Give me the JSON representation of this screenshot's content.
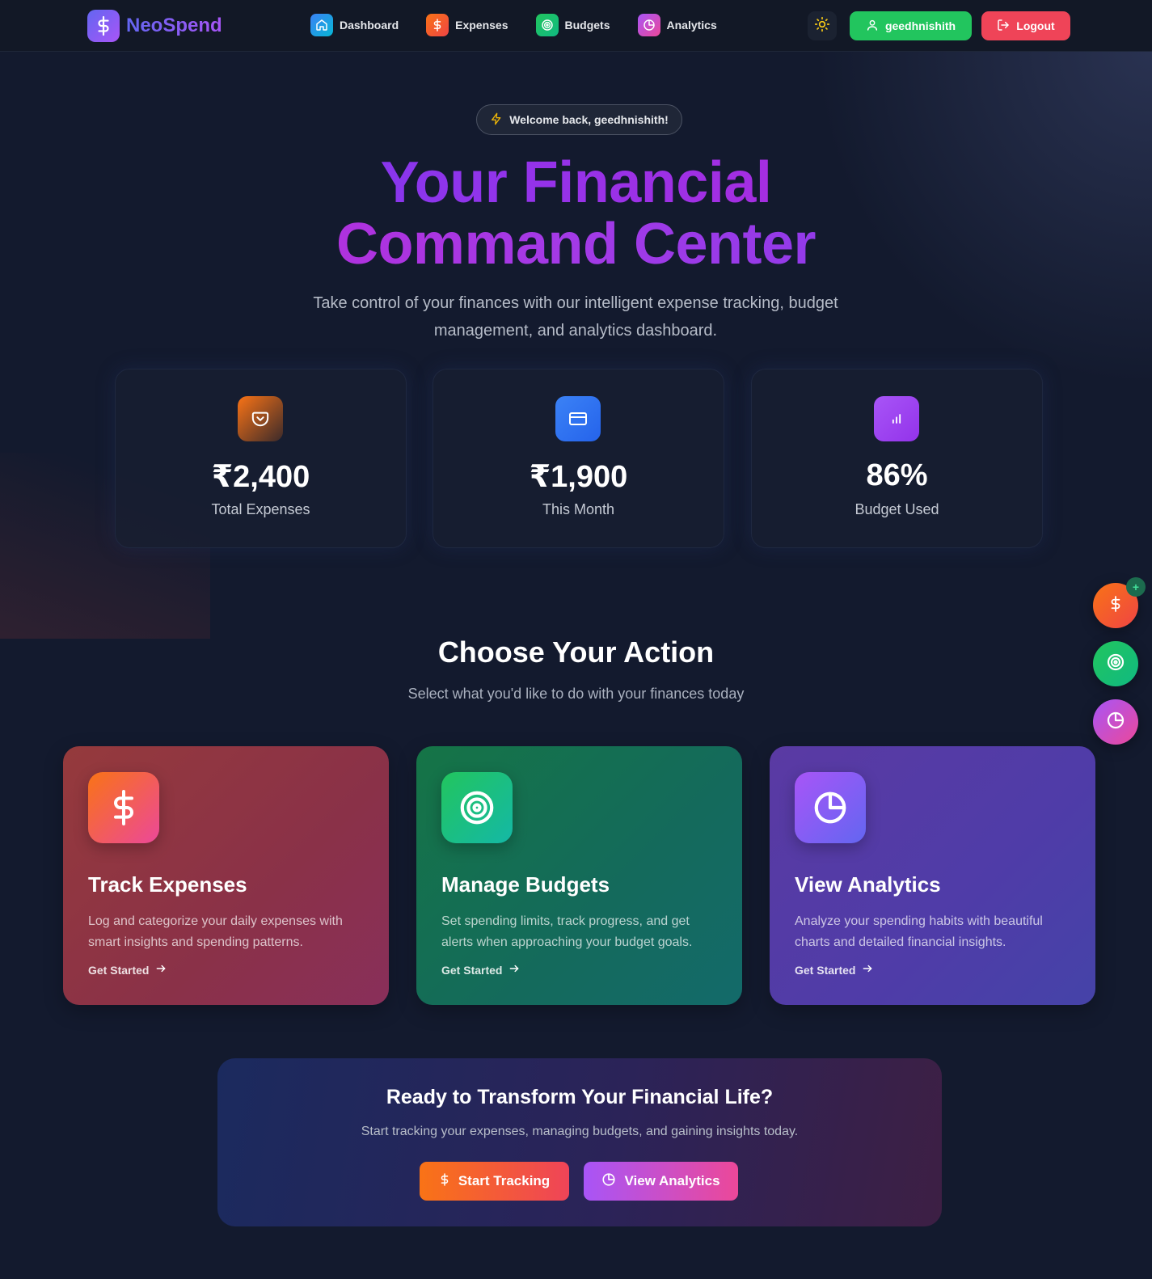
{
  "nav": {
    "brand": "NeoSpend",
    "links": [
      {
        "label": "Dashboard",
        "icon": "home-icon",
        "color": "#3b82f6"
      },
      {
        "label": "Expenses",
        "icon": "dollar-icon",
        "color": "#f97316"
      },
      {
        "label": "Budgets",
        "icon": "target-icon",
        "color": "#22c55e"
      },
      {
        "label": "Analytics",
        "icon": "pie-chart-icon",
        "color": "#a855f7"
      }
    ],
    "theme_icon": "sun-icon",
    "user_label": "geedhnishith",
    "logout_label": "Logout"
  },
  "hero": {
    "welcome": "Welcome back, geedhnishith!",
    "title_line1": "Your Financial",
    "title_line2": "Command Center",
    "subtitle": "Take control of your finances with our intelligent expense tracking, budget management, and analytics dashboard."
  },
  "stats": [
    {
      "value": "₹2,400",
      "label": "Total Expenses",
      "icon": "pocket-icon"
    },
    {
      "value": "₹1,900",
      "label": "This Month",
      "icon": "credit-card-icon"
    },
    {
      "value": "86%",
      "label": "Budget Used",
      "icon": "bar-chart-icon"
    }
  ],
  "actions": {
    "title": "Choose Your Action",
    "subtitle": "Select what you'd like to do with your finances today",
    "cards": [
      {
        "title": "Track Expenses",
        "description": "Log and categorize your daily expenses with smart insights and spending patterns.",
        "link": "Get Started",
        "icon": "dollar-icon"
      },
      {
        "title": "Manage Budgets",
        "description": "Set spending limits, track progress, and get alerts when approaching your budget goals.",
        "link": "Get Started",
        "icon": "target-icon"
      },
      {
        "title": "View Analytics",
        "description": "Analyze your spending habits with beautiful charts and detailed financial insights.",
        "link": "Get Started",
        "icon": "pie-chart-icon"
      }
    ]
  },
  "fab": {
    "badge": "+",
    "buttons": [
      "dollar-icon",
      "target-icon",
      "pie-chart-icon"
    ]
  },
  "cta": {
    "title": "Ready to Transform Your Financial Life?",
    "subtitle": "Start tracking your expenses, managing budgets, and gaining insights today.",
    "primary_label": "Start Tracking",
    "secondary_label": "View Analytics"
  },
  "colors": {
    "background": "#131a2e",
    "success": "#22c55e",
    "danger": "#ef4458",
    "orange": "#f97316",
    "purple": "#a855f7"
  }
}
